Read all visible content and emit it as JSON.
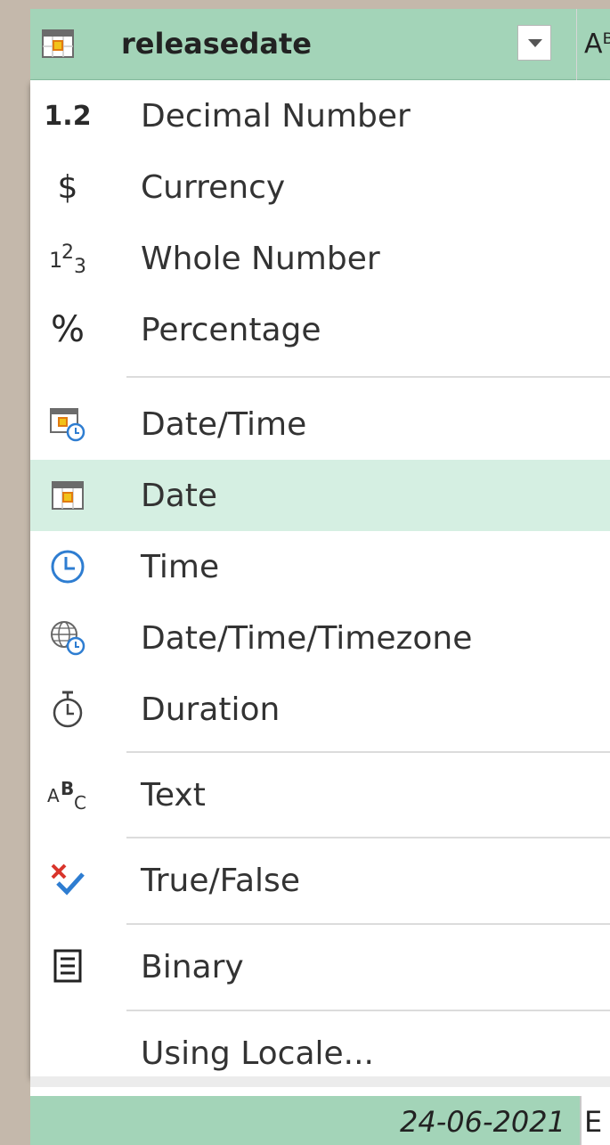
{
  "header": {
    "column_name": "releasedate",
    "next_column_partial": "Aᴮ"
  },
  "menu": {
    "items": [
      {
        "label": "Decimal Number",
        "icon": "decimal-number-icon",
        "icon_text": "1.2"
      },
      {
        "label": "Currency",
        "icon": "currency-icon",
        "icon_text": "$"
      },
      {
        "label": "Whole Number",
        "icon": "whole-number-icon",
        "icon_text": "1²₃"
      },
      {
        "label": "Percentage",
        "icon": "percentage-icon",
        "icon_text": "%"
      },
      {
        "label": "Date/Time",
        "icon": "date-time-icon"
      },
      {
        "label": "Date",
        "icon": "date-icon",
        "selected": true
      },
      {
        "label": "Time",
        "icon": "time-icon"
      },
      {
        "label": "Date/Time/Timezone",
        "icon": "date-time-timezone-icon"
      },
      {
        "label": "Duration",
        "icon": "duration-icon"
      },
      {
        "label": "Text",
        "icon": "text-icon"
      },
      {
        "label": "True/False",
        "icon": "true-false-icon"
      },
      {
        "label": "Binary",
        "icon": "binary-icon"
      },
      {
        "label": "Using Locale...",
        "icon": ""
      }
    ]
  },
  "data_row": {
    "value": "24-06-2021",
    "next_partial": "E"
  },
  "colors": {
    "header_bg": "#a3d4b8",
    "selected_bg": "#d5efe2",
    "accent_blue": "#2e7dd1",
    "accent_red": "#d9342b"
  }
}
